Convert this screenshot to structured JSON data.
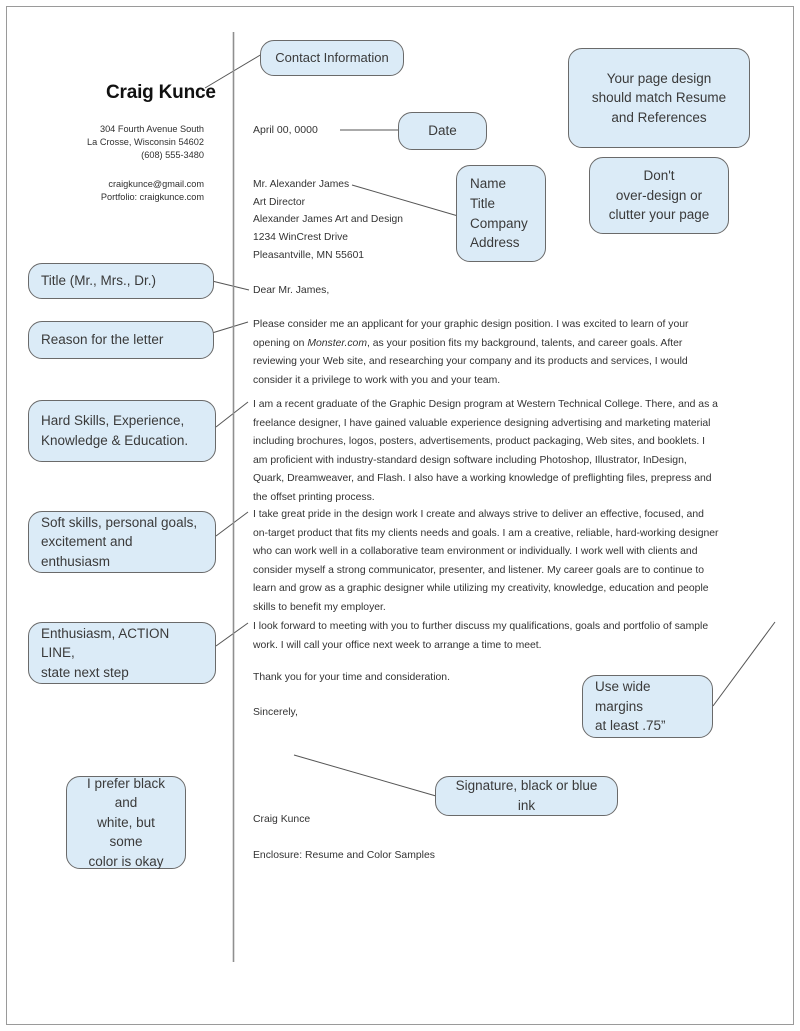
{
  "document_type": "Annotated cover letter sample",
  "colors": {
    "callout_fill": "#dbebf7",
    "callout_border": "#6a6a6a",
    "page_border": "#9a9a9a",
    "divider": "#8f8f8f",
    "body_text": "#333333"
  },
  "letter": {
    "sender_name": "Craig Kunce",
    "sender_contact": [
      "304 Fourth Avenue South",
      "La Crosse, Wisconsin 54602",
      "(608) 555-3480"
    ],
    "sender_online": [
      "craigkunce@gmail.com",
      "Portfolio: craigkunce.com"
    ],
    "date": "April 00, 0000",
    "recipient": [
      "Mr. Alexander James",
      "Art Director",
      "Alexander James Art and Design",
      "1234 WinCrest Drive",
      "Pleasantville, MN 55601"
    ],
    "salutation": "Dear Mr. James,",
    "paragraph_1_pre": "Please consider me an applicant for your graphic design position. I was excited to learn of your opening on ",
    "paragraph_1_em": "Monster.com",
    "paragraph_1_post": ", as your position fits my background, talents, and career goals. After reviewing your Web site, and researching your company and its products and services, I would consider it a privilege to work with you and your team.",
    "paragraph_2": "I am a recent graduate of the Graphic Design program at Western Technical College. There, and as a freelance designer, I have gained valuable experience designing advertising and marketing material including brochures, logos, posters, advertisements, product packaging, Web sites, and booklets. I am proficient with industry-standard design software including Photoshop, Illustrator, InDesign, Quark, Dreamweaver, and Flash. I also have a working knowledge of preflighting files, prepress and the offset printing process.",
    "paragraph_3": "I take great pride in the design work I create and always strive to deliver an effective, focused, and on-target product that fits my clients needs and goals. I am a creative, reliable, hard-working designer who can work well in a collaborative team environment or individually. I work well with clients and consider myself a strong communicator, presenter, and listener. My career goals are to continue to learn and grow as a graphic designer while utilizing my creativity, knowledge, education and people skills to benefit my employer.",
    "paragraph_4": "I look forward to meeting with you to further discuss my qualifications, goals and portfolio of sample work. I will call your office next week to arrange a time to meet.",
    "thank_you": "Thank you for your time and consideration.",
    "closing": "Sincerely,",
    "signature_name": "Craig Kunce",
    "enclosure": "Enclosure: Resume and Color Samples"
  },
  "callouts": {
    "contact_information": "Contact Information",
    "page_design": "Your page design\nshould match Resume\nand References",
    "date": "Date",
    "dont_overdesign": "Don't\nover-design or\nclutter your page",
    "name_title_company_address": "Name\nTitle\nCompany\nAddress",
    "title_salutation": "Title (Mr., Mrs., Dr.)",
    "reason_for_letter": "Reason for the letter",
    "hard_skills": "Hard Skills, Experience,\nKnowledge & Education.",
    "soft_skills": "Soft skills, personal goals,\nexcitement and enthusiasm",
    "enthusiasm_action": "Enthusiasm, ACTION LINE,\nstate next step",
    "wide_margins": "Use wide margins\nat least .75”",
    "signature_ink": "Signature, black or blue ink",
    "black_and_white": "I prefer black and\nwhite, but some\ncolor is okay"
  }
}
